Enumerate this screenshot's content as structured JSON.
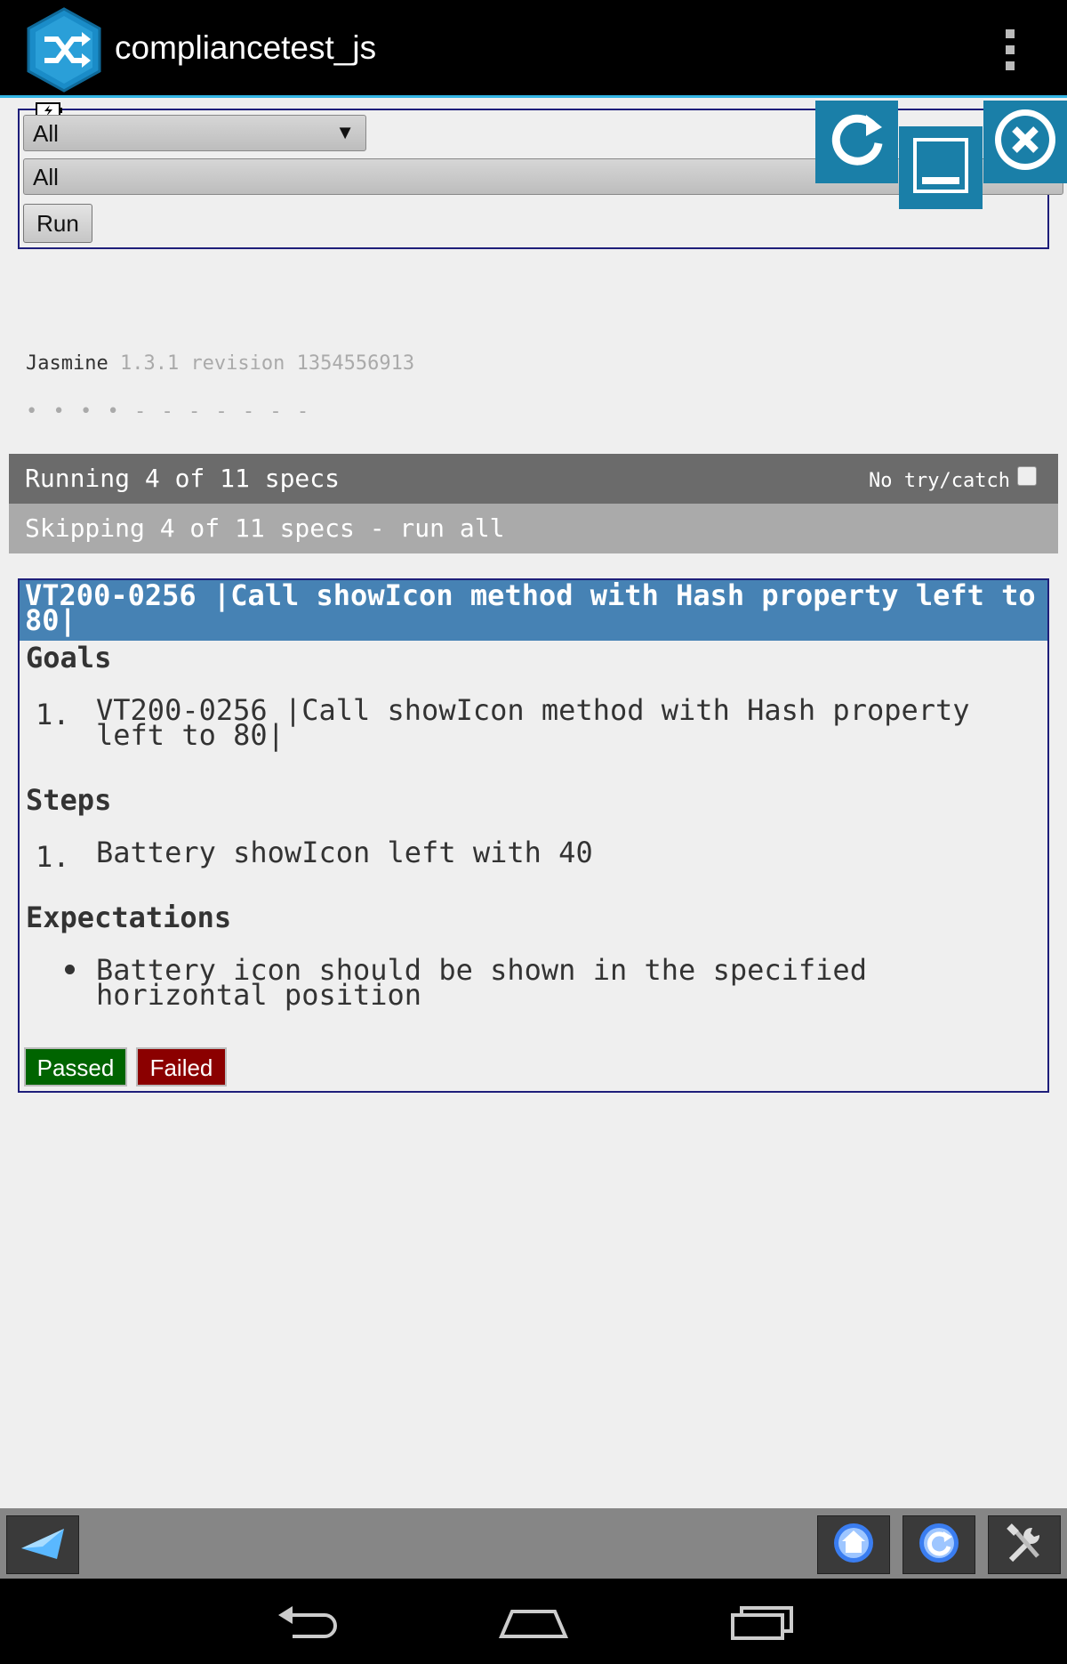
{
  "app": {
    "title": "compliancetest_js"
  },
  "form": {
    "select1_value": "All",
    "select1_arrow": "▼",
    "select2_value": "All",
    "run_label": "Run"
  },
  "jasmine": {
    "name": "Jasmine",
    "version": "1.3.1 revision 1354556913",
    "dots": "• • • • - - - - - - -",
    "running": "Running 4 of 11 specs",
    "no_try_catch": "No try/catch",
    "skipping": "Skipping 4 of 11 specs - run all"
  },
  "spec": {
    "title": "VT200-0256 |Call showIcon method with Hash property left to 80|",
    "goals_heading": "Goals",
    "goals": [
      "VT200-0256 |Call showIcon method with Hash property left to 80|"
    ],
    "steps_heading": "Steps",
    "steps": [
      "Battery showIcon left with 40"
    ],
    "expectations_heading": "Expectations",
    "expectations": [
      "Battery icon should be shown in the specified horizontal position"
    ],
    "passed_label": "Passed",
    "failed_label": "Failed"
  },
  "list_markers": [
    "1.",
    "1."
  ],
  "colors": {
    "actionbar": "#000000",
    "accent": "#33b5e5",
    "spec_title_bg": "#4682b4",
    "passed": "#006400",
    "failed": "#8b0000",
    "float_btn": "#1a7fa8"
  },
  "icons": {
    "app": "shuffle-hexagon-icon",
    "overflow": "overflow-menu-icon",
    "refresh": "refresh-icon",
    "minimize": "minimize-icon",
    "close": "close-icon",
    "back": "back-arrow-icon",
    "home": "home-icon",
    "reload": "reload-icon",
    "settings": "settings-icon"
  }
}
